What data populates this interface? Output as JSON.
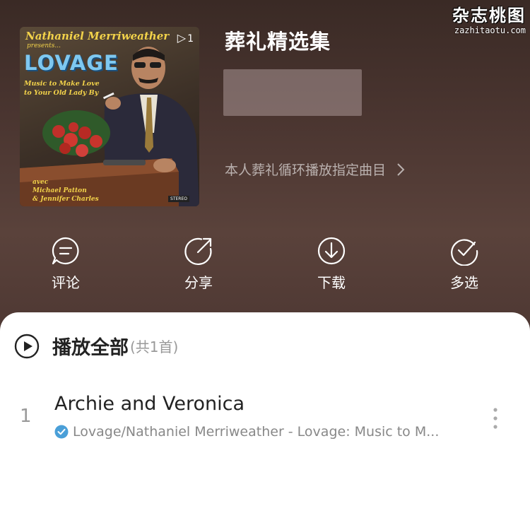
{
  "watermark": {
    "title": "杂志桃图",
    "url": "zazhitaotu.com"
  },
  "album_cover": {
    "artist": "Nathaniel Merriweather",
    "presents": "presents...",
    "title": "LOVAGE",
    "subtitle": "Music to Make Love to Your Old Lady By",
    "credits_line1": "avec",
    "credits_line2": "Michael Patton",
    "credits_line3": "& Jennifer Charles",
    "play_count": "1",
    "stereo": "STEREO"
  },
  "playlist": {
    "title": "葬礼精选集",
    "description": "本人葬礼循环播放指定曲目"
  },
  "actions": [
    {
      "label": "评论",
      "icon": "comment-icon"
    },
    {
      "label": "分享",
      "icon": "share-icon"
    },
    {
      "label": "下载",
      "icon": "download-icon"
    },
    {
      "label": "多选",
      "icon": "multi-select-icon"
    }
  ],
  "play_all": {
    "label": "播放全部",
    "count": "(共1首)"
  },
  "tracks": [
    {
      "index": "1",
      "name": "Archie and Veronica",
      "subtitle": "Lovage/Nathaniel Merriweather - Lovage: Music to M..."
    }
  ],
  "colors": {
    "header_bg": "#4a3530",
    "verified": "#4a9fd8",
    "text_dark": "#222222",
    "text_muted": "#888888"
  }
}
